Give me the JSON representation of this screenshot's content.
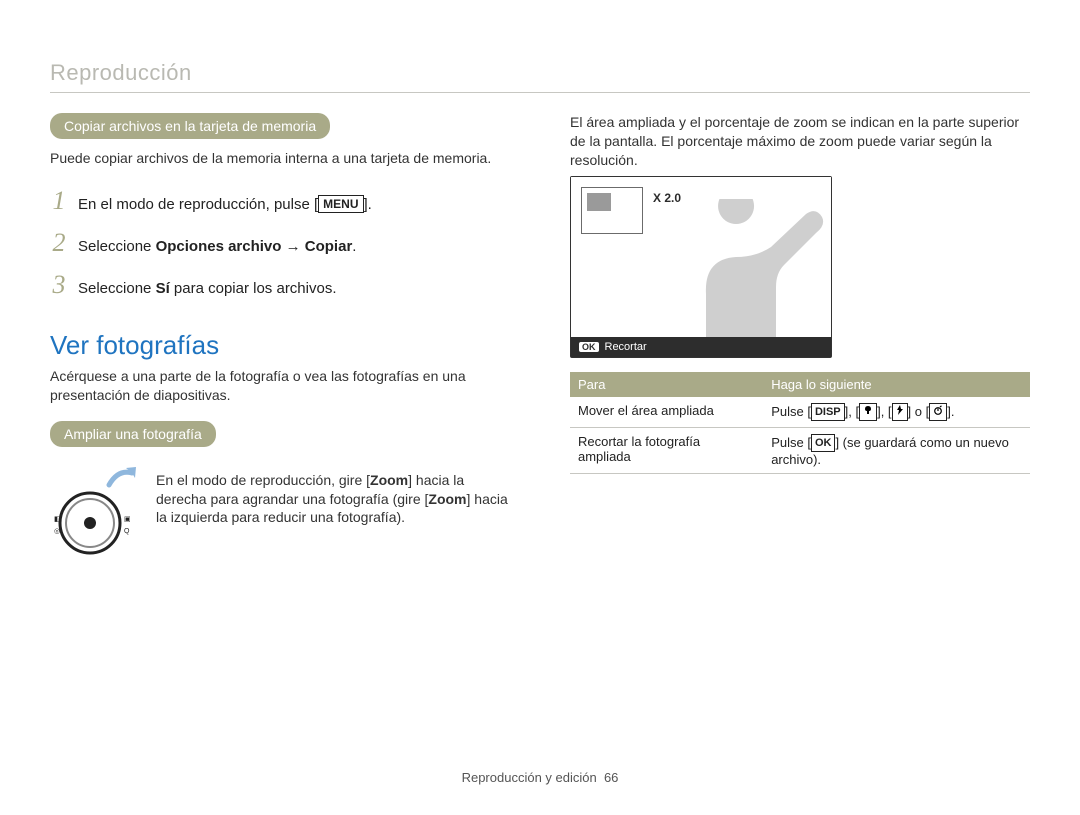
{
  "header": {
    "title": "Reproducción"
  },
  "left": {
    "pill1": "Copiar archivos en la tarjeta de memoria",
    "intro1": "Puede copiar archivos de la memoria interna a una tarjeta de memoria.",
    "steps": [
      {
        "num": "1",
        "pre": "En el modo de reproducción, pulse [",
        "btn": "MENU",
        "post": "]."
      },
      {
        "num": "2",
        "pre": "Seleccione ",
        "bold": "Opciones archivo → Copiar",
        "post": "."
      },
      {
        "num": "3",
        "pre": "Seleccione ",
        "bold": "Sí",
        "post": " para copiar los archivos."
      }
    ],
    "h2": "Ver fotografías",
    "intro2": "Acérquese a una parte de la fotografía o vea las fotografías en una presentación de diapositivas.",
    "pill2": "Ampliar una fotografía",
    "zoom": {
      "line1_pre": "En el modo de reproducción, gire [",
      "line1_bold1": "Zoom",
      "line1_mid": "] hacia la derecha para agrandar una fotografía (gire [",
      "line1_bold2": "Zoom",
      "line1_post": "] hacia la izquierda para reducir una fotografía)."
    }
  },
  "right": {
    "intro": "El área ampliada y el porcentaje de zoom se indican en la parte superior de la pantalla. El porcentaje máximo de zoom puede variar según la resolución.",
    "zoom_label": "X 2.0",
    "screen_bar": {
      "ok": "OK",
      "label": "Recortar"
    },
    "table": {
      "head": [
        "Para",
        "Haga lo siguiente"
      ],
      "rows": [
        {
          "c1": "Mover el área ampliada",
          "c2_pre": "Pulse [",
          "btns": [
            "DISP",
            "flower-icon",
            "flash-icon",
            "timer-icon"
          ],
          "joiners": [
            "], [",
            "], [",
            "] o [",
            "]."
          ]
        },
        {
          "c1": "Recortar la fotografía ampliada",
          "c2_pre": "Pulse [",
          "btn": "OK",
          "c2_post": "] (se guardará como un nuevo archivo)."
        }
      ]
    }
  },
  "footer": {
    "text": "Reproducción y edición",
    "page": "66"
  }
}
